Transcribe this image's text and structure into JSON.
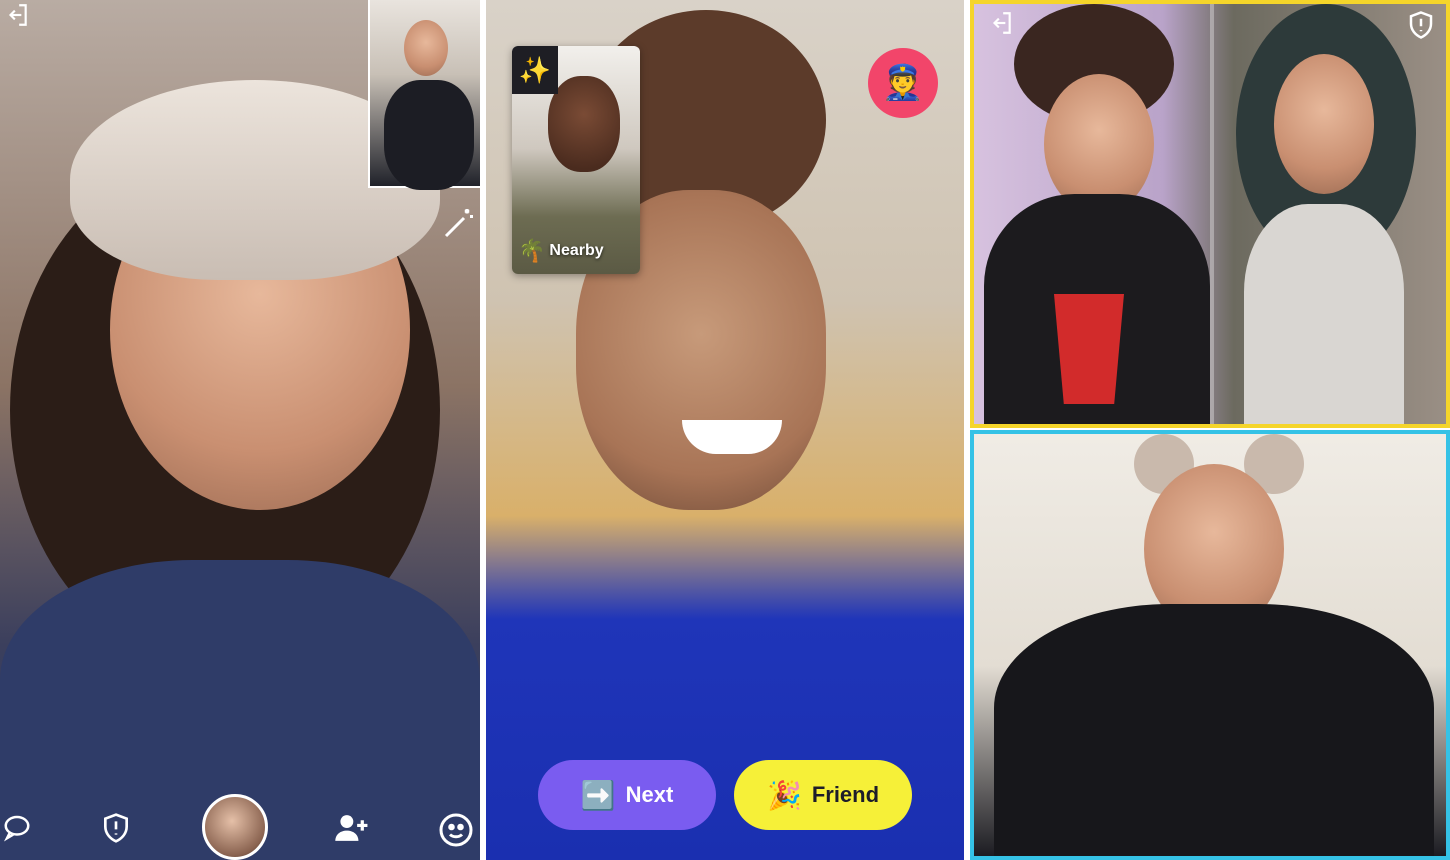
{
  "left_panel": {
    "icons": {
      "exit": "exit-icon",
      "wand": "magic-wand-icon",
      "chat": "chat-bubble-icon",
      "shield": "shield-alert-icon",
      "add_friend": "add-friend-icon",
      "face": "face-filter-icon"
    }
  },
  "center_panel": {
    "nearby_card": {
      "label": "Nearby",
      "sparkle_icon": "✨",
      "palm_icon": "🌴"
    },
    "police_icon": "👮",
    "next_button": {
      "emoji": "➡️",
      "label": "Next"
    },
    "friend_button": {
      "emoji": "🎉",
      "label": "Friend"
    }
  },
  "right_panel": {
    "icons": {
      "exit": "exit-icon",
      "shield": "shield-alert-icon"
    },
    "tile_top_border": "#f5d52a",
    "tile_bottom_border": "#35c2e6"
  },
  "colors": {
    "next": "#7a5cf0",
    "friend": "#f6f038",
    "police": "#f2456a"
  }
}
